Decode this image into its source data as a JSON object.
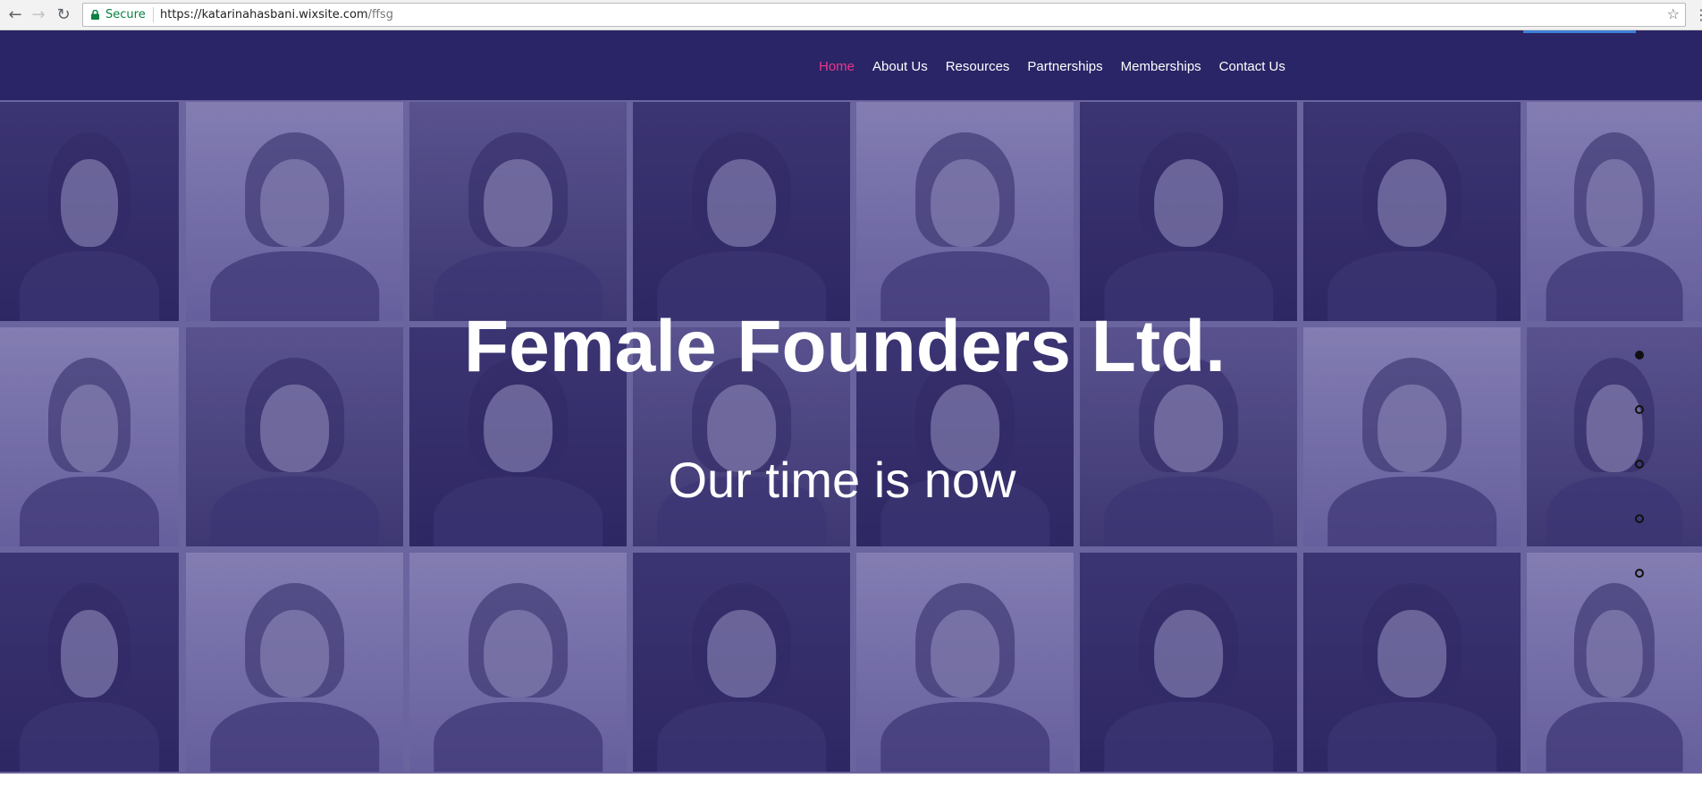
{
  "browser": {
    "secure_label": "Secure",
    "url_host": "https://katarinahasbani.wixsite.com",
    "url_path": "/ffsg",
    "icons": [
      "back-arrow-icon",
      "forward-arrow-icon",
      "reload-icon",
      "lock-icon",
      "star-icon",
      "menu-icon"
    ]
  },
  "nav": {
    "items": [
      {
        "label": "Home",
        "active": true
      },
      {
        "label": "About Us",
        "active": false
      },
      {
        "label": "Resources",
        "active": false
      },
      {
        "label": "Partnerships",
        "active": false
      },
      {
        "label": "Memberships",
        "active": false
      },
      {
        "label": "Contact Us",
        "active": false
      }
    ]
  },
  "hero": {
    "title": "Female Founders Ltd.",
    "subtitle": "Our time is now",
    "slides": {
      "count": 5,
      "active_index": 0
    }
  },
  "colors": {
    "header_bg": "#2a2566",
    "nav_active": "#e9368a",
    "hero_tint": "#6f6aa2",
    "header_accent": "#3d7fd9"
  }
}
